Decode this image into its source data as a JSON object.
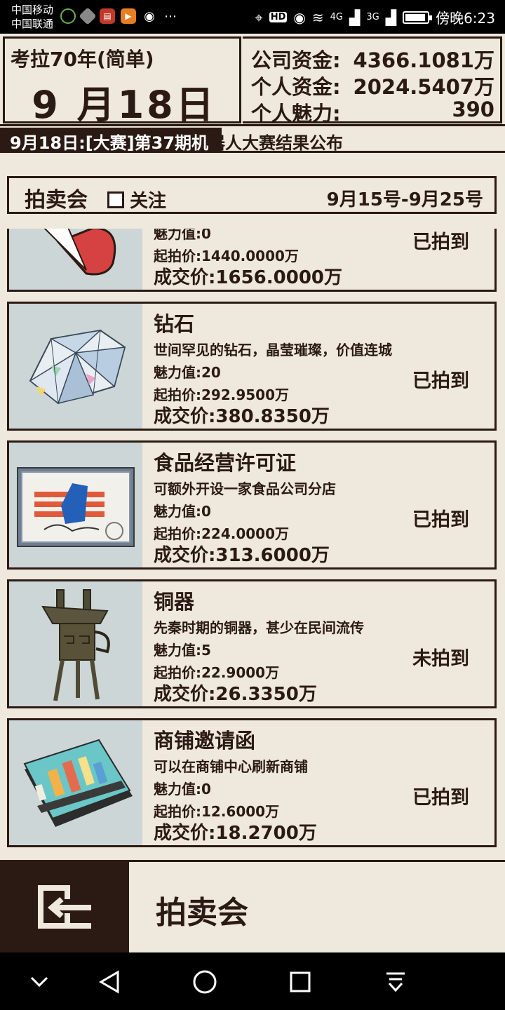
{
  "status_bar": {
    "carrier1": "中国移动",
    "carrier2": "中国联通",
    "hd": "HD",
    "net4g": "4G",
    "net3g": "3G",
    "time": "傍晚6:23"
  },
  "header": {
    "game_title": "考拉70年(简单)",
    "date": "9 月18日",
    "stats": [
      {
        "label": "公司资金:",
        "value": "4366.1081万"
      },
      {
        "label": "个人资金:",
        "value": "2024.5407万"
      },
      {
        "label": "个人魅力:",
        "value": "390"
      }
    ]
  },
  "ticker": {
    "part1": "9月18日:[大赛]第37期机",
    "part2": "器人大赛结果公布"
  },
  "section": {
    "title": "拍卖会",
    "follow_label": "关注",
    "period": "9月15号-9月25号"
  },
  "items": [
    {
      "name": "",
      "desc": "",
      "charm": "魅力值:0",
      "start": "起拍价:1440.0000万",
      "final": "成交价:1656.0000万",
      "status": "已拍到",
      "icon": "red-item-icon"
    },
    {
      "name": "钻石",
      "desc": "世间罕见的钻石，晶莹璀璨，价值连城",
      "charm": "魅力值:20",
      "start": "起拍价:292.9500万",
      "final": "成交价:380.8350万",
      "status": "已拍到",
      "icon": "diamond-icon"
    },
    {
      "name": "食品经营许可证",
      "desc": "可额外开设一家食品公司分店",
      "charm": "魅力值:0",
      "start": "起拍价:224.0000万",
      "final": "成交价:313.6000万",
      "status": "已拍到",
      "icon": "certificate-icon"
    },
    {
      "name": "铜器",
      "desc": "先秦时期的铜器，甚少在民间流传",
      "charm": "魅力值:5",
      "start": "起拍价:22.9000万",
      "final": "成交价:26.3350万",
      "status": "未拍到",
      "icon": "bronze-vessel-icon"
    },
    {
      "name": "商铺邀请函",
      "desc": "可以在商铺中心刷新商铺",
      "charm": "魅力值:0",
      "start": "起拍价:12.6000万",
      "final": "成交价:18.2700万",
      "status": "已拍到",
      "icon": "invitation-book-icon"
    }
  ],
  "bottom": {
    "title": "拍卖会"
  }
}
